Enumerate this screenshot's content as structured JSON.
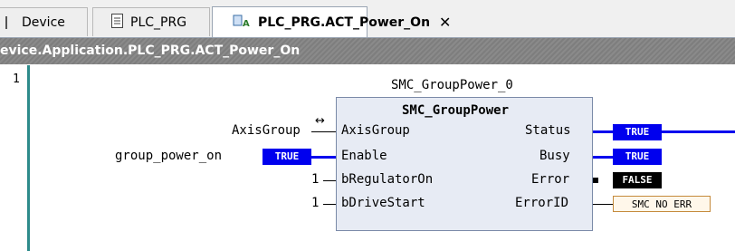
{
  "tabs": [
    {
      "label": "Device"
    },
    {
      "label": "PLC_PRG"
    },
    {
      "label": "PLC_PRG.ACT_Power_On",
      "close": "✕"
    }
  ],
  "path": "evice.Application.PLC_PRG.ACT_Power_On",
  "line_number": "1",
  "block": {
    "instance": "SMC_GroupPower_0",
    "type": "SMC_GroupPower",
    "inputs": [
      {
        "name": "AxisGroup",
        "value": "AxisGroup",
        "connector": "↔"
      },
      {
        "name": "Enable",
        "value": "group_power_on",
        "badge": "TRUE"
      },
      {
        "name": "bRegulatorOn",
        "value": "1"
      },
      {
        "name": "bDriveStart",
        "value": "1"
      }
    ],
    "outputs": [
      {
        "name": "Status",
        "badge": "TRUE"
      },
      {
        "name": "Busy",
        "badge": "TRUE"
      },
      {
        "name": "Error",
        "badge": "FALSE"
      },
      {
        "name": "ErrorID",
        "badge": "SMC NO ERR"
      }
    ]
  },
  "colors": {
    "true_bg": "#0000ee",
    "false_bg": "#000000",
    "gutter": "#2e8b8b",
    "block_bg": "#e7ebf4"
  }
}
